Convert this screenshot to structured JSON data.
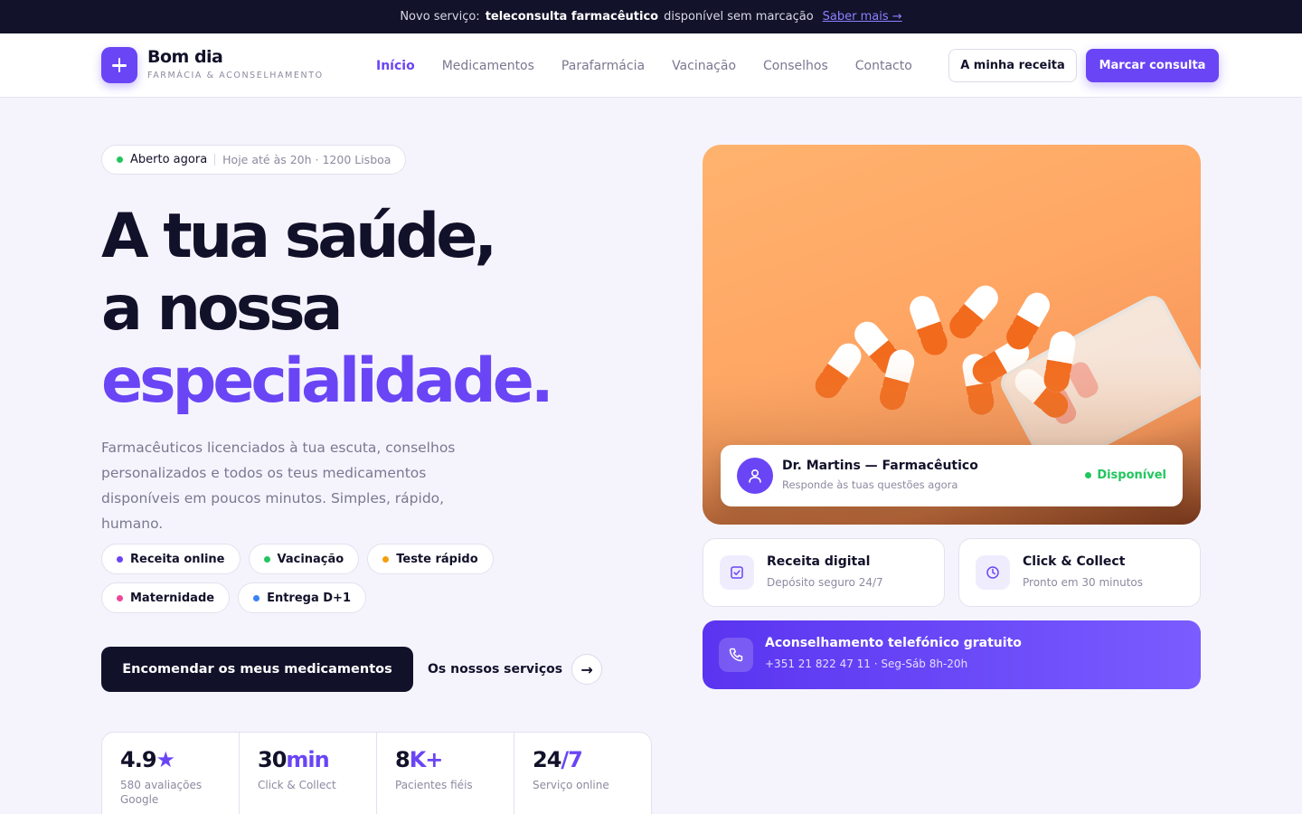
{
  "announcement": {
    "prefix": "Novo serviço:",
    "highlight": "teleconsulta farmacêutico",
    "suffix": "disponível sem marcação",
    "link": "Saber mais →"
  },
  "header": {
    "brand_name": "Bom dia",
    "brand_subtitle": "FARMÁCIA & ACONSELHAMENTO",
    "nav": [
      "Início",
      "Medicamentos",
      "Parafarmácia",
      "Vacinação",
      "Conselhos",
      "Contacto"
    ],
    "active_nav": "Início",
    "secondary_button": "A minha receita",
    "primary_button": "Marcar consulta"
  },
  "hero": {
    "status": {
      "label": "Aberto agora",
      "detail": "Hoje até às 20h · 1200 Lisboa",
      "color": "#22c55e"
    },
    "title_line1": "A tua saúde,",
    "title_line2": "a nossa",
    "title_accent": "especialidade.",
    "lead": "Farmacêuticos licenciados à tua escuta, conselhos personalizados e todos os teus medicamentos disponíveis em poucos minutos. Simples, rápido, humano.",
    "tags": [
      {
        "label": "Receita online",
        "color": "#6a45f5"
      },
      {
        "label": "Vacinação",
        "color": "#22c55e"
      },
      {
        "label": "Teste rápido",
        "color": "#f59e0b"
      },
      {
        "label": "Maternidade",
        "color": "#ec4899"
      },
      {
        "label": "Entrega D+1",
        "color": "#3b82f6"
      }
    ],
    "cta_primary": "Encomendar os meus medicamentos",
    "cta_secondary": "Os nossos serviços",
    "cta_arrow": "→"
  },
  "stats": [
    {
      "value": "4.9",
      "accent": "★",
      "label": "580 avaliações Google"
    },
    {
      "value": "30",
      "accent": "min",
      "label": "Click & Collect"
    },
    {
      "value": "8",
      "accent": "K+",
      "label": "Pacientes fiéis"
    },
    {
      "value": "24",
      "accent": "/7",
      "label": "Serviço online"
    }
  ],
  "pharmacist_card": {
    "name": "Dr. Martins — Farmacêutico",
    "subtitle": "Responde às tuas questões agora",
    "status": "Disponível",
    "icon": "user-icon"
  },
  "feature_cards": [
    {
      "title": "Receita digital",
      "subtitle": "Depósito seguro 24/7",
      "icon": "check-square-icon"
    },
    {
      "title": "Click & Collect",
      "subtitle": "Pronto em 30 minutos",
      "icon": "clock-icon"
    }
  ],
  "phone_card": {
    "title": "Aconselhamento telefónico gratuito",
    "subtitle": "+351 21 822 47 11 · Seg-Sáb 8h-20h",
    "icon": "phone-icon"
  },
  "colors": {
    "accent": "#6a45f5",
    "dark": "#12112a",
    "success": "#22c55e"
  }
}
